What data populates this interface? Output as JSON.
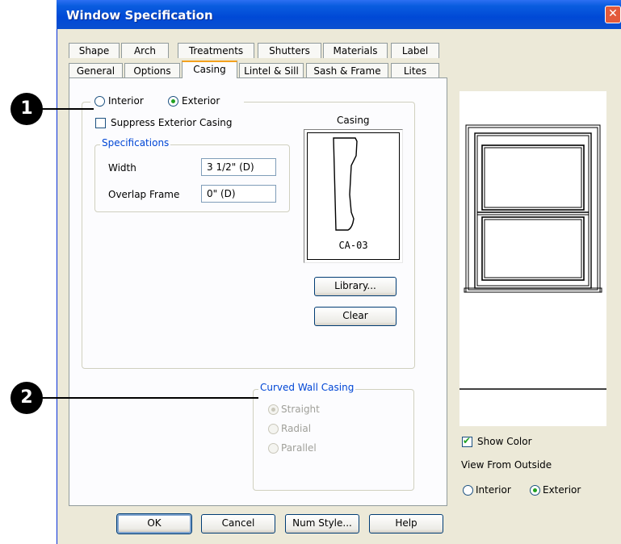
{
  "window": {
    "title": "Window Specification",
    "close_glyph": "✕"
  },
  "tabs_row1": [
    "Shape",
    "Arch",
    "Treatments",
    "Shutters",
    "Materials",
    "Label"
  ],
  "tabs_row2": [
    "General",
    "Options",
    "Casing",
    "Lintel & Sill",
    "Sash & Frame",
    "Lites"
  ],
  "active_tab": "Casing",
  "casing": {
    "interior_label": "Interior",
    "exterior_label": "Exterior",
    "selected_side": "Exterior",
    "suppress_label": "Suppress Exterior Casing",
    "suppress_checked": false,
    "specs_legend": "Specifications",
    "width_label": "Width",
    "width_value": "3 1/2\" (D)",
    "overlap_label": "Overlap Frame",
    "overlap_value": "0\" (D)",
    "preview_title": "Casing",
    "profile_name": "CA-03",
    "library_button": "Library...",
    "clear_button": "Clear"
  },
  "curved_wall": {
    "legend": "Curved Wall Casing",
    "options": [
      "Straight",
      "Radial",
      "Parallel"
    ],
    "selected": "Straight"
  },
  "preview": {
    "show_color_label": "Show Color",
    "show_color_checked": true,
    "view_label": "View From Outside",
    "interior_label": "Interior",
    "exterior_label": "Exterior",
    "selected_view": "Exterior"
  },
  "buttons": {
    "ok": "OK",
    "cancel": "Cancel",
    "num_style": "Num Style...",
    "help": "Help"
  },
  "callouts": [
    "1",
    "2"
  ],
  "colors": {
    "title_bar": "#0a5ddf",
    "dialog_bg": "#ece9d8",
    "active_tab_accent": "#f4a11d",
    "legend_blue": "#0046d5"
  }
}
